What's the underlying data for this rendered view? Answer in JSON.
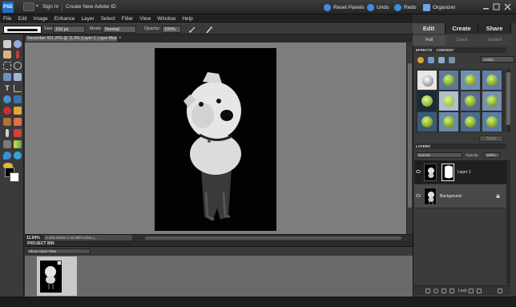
{
  "titlebar": {
    "app_logo": "PSE",
    "sign_in": "Sign In",
    "create_id": "Create New Adobe ID",
    "reset_panels": "Reset Panels",
    "undo": "Undo",
    "redo": "Redo",
    "organizer": "Organizer"
  },
  "menu": [
    "File",
    "Edit",
    "Image",
    "Enhance",
    "Layer",
    "Select",
    "Filter",
    "View",
    "Window",
    "Help"
  ],
  "options": {
    "size_label": "Size:",
    "size_value": "169 px",
    "mode_label": "Mode:",
    "mode_value": "Normal",
    "opacity_label": "Opacity:",
    "opacity_value": "100%"
  },
  "document": {
    "tab_title": "December 021.JPG @ 11.9% (Layer 1, Layer Mask/8)*",
    "tab_close": "×",
    "zoom": "11.94%",
    "doc_info": "5.493 inches x 34.299 inches (..."
  },
  "project_bin": {
    "title": "PROJECT BIN",
    "show_select": "Show Open Files"
  },
  "right_panel": {
    "mode_tabs": [
      "Edit",
      "Create",
      "Share"
    ],
    "sub_tabs": [
      "Full",
      "Quick",
      "Guided"
    ],
    "effects_tabs": [
      "EFFECTS",
      "CONTENT"
    ],
    "effects_select": "Artistic",
    "apply_label": "Apply",
    "layers_title": "LAYERS",
    "blend_mode": "Normal",
    "opacity_label": "Opacity:",
    "opacity_value": "100%",
    "layers": [
      {
        "name": "Layer 1",
        "selected": true
      },
      {
        "name": "Background",
        "selected": false
      }
    ],
    "lock_label": "Lock:"
  },
  "icons": {
    "toolbox": [
      "move-icon",
      "zoom-icon",
      "hand-icon",
      "eyedropper-icon",
      "marquee-icon",
      "lasso-icon",
      "magic-wand-icon",
      "selection-brush-icon",
      "type-icon",
      "crop-icon",
      "cookie-cutter-icon",
      "straighten-icon",
      "red-eye-icon",
      "spot-healing-icon",
      "clone-stamp-icon",
      "eraser-icon",
      "brush-icon",
      "smart-brush-icon",
      "paint-bucket-icon",
      "gradient-icon",
      "shape-icon",
      "blur-icon",
      "sponge-icon"
    ],
    "colors": {
      "foreground": "#000000",
      "background": "#ffffff",
      "accent": "#3d8fe0"
    }
  }
}
